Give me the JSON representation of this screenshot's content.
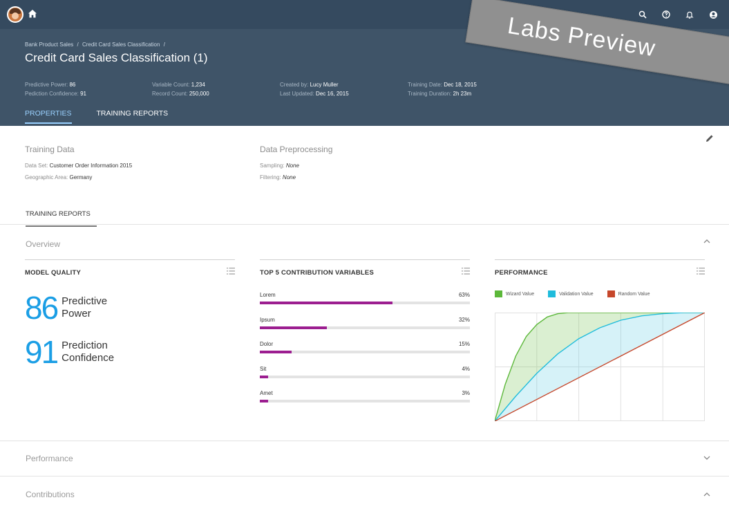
{
  "ribbon": {
    "text": "Labs Preview"
  },
  "breadcrumb": [
    "Bank Product Sales",
    "/",
    "Credit Card Sales Classification",
    "/"
  ],
  "title": "Credit Card Sales Classification (1)",
  "attributes": [
    [
      {
        "label": "Predictive Power:",
        "value": "86"
      },
      {
        "label": "Pediction Confidence:",
        "value": "91"
      }
    ],
    [
      {
        "label": "Variable Count:",
        "value": "1,234"
      },
      {
        "label": "Record Count:",
        "value": "250,000"
      }
    ],
    [
      {
        "label": "Created by:",
        "value": "Lucy Muller"
      },
      {
        "label": "Last Updated:",
        "value": "Dec 16, 2015"
      }
    ],
    [
      {
        "label": "Training Date:",
        "value": "Dec 18, 2015"
      },
      {
        "label": "Training Duration:",
        "value": "2h 23m"
      }
    ]
  ],
  "header_tabs": [
    {
      "label": "PROPERTIES",
      "active": true
    },
    {
      "label": "TRAINING REPORTS",
      "active": false
    }
  ],
  "training_data": {
    "title": "Training Data",
    "rows": [
      {
        "label": "Data Set:",
        "value": "Customer Order Information 2015"
      },
      {
        "label": "Geographic Area:",
        "value": "Germany"
      }
    ]
  },
  "data_preprocessing": {
    "title": "Data Preprocessing",
    "rows": [
      {
        "label": "Sampling:",
        "value": "None"
      },
      {
        "label": "Filtering:",
        "value": "None"
      }
    ]
  },
  "training_reports_tab": "TRAINING REPORTS",
  "panels": {
    "overview": "Overview",
    "performance": "Performance",
    "contributions": "Contributions"
  },
  "model_quality": {
    "title": "MODEL QUALITY",
    "kpis": [
      {
        "value": "86",
        "label": "Predictive Power"
      },
      {
        "value": "91",
        "label": "Prediction Confidence"
      }
    ]
  },
  "contribution": {
    "title": "TOP 5 CONTRIBUTION VARIABLES",
    "items": [
      {
        "name": "Lorem",
        "value": 63,
        "pct": "63%"
      },
      {
        "name": "Ipsum",
        "value": 32,
        "pct": "32%"
      },
      {
        "name": "Dolor",
        "value": 15,
        "pct": "15%"
      },
      {
        "name": "Sit",
        "value": 4,
        "pct": "4%"
      },
      {
        "name": "Amet",
        "value": 3,
        "pct": "3%"
      }
    ]
  },
  "performance": {
    "title": "PERFORMANCE"
  },
  "chart_data": {
    "type": "area",
    "title": "PERFORMANCE",
    "xlabel": "",
    "ylabel": "",
    "xlim": [
      0,
      1
    ],
    "ylim": [
      0,
      1
    ],
    "grid": true,
    "legend_position": "top-left",
    "series": [
      {
        "name": "Wizard Value",
        "color": "#5cb83a",
        "x": [
          0,
          0.05,
          0.1,
          0.15,
          0.2,
          0.25,
          0.3,
          0.35,
          0.4,
          0.45,
          0.5,
          1.0
        ],
        "y": [
          0,
          0.34,
          0.6,
          0.78,
          0.89,
          0.96,
          0.99,
          1.0,
          1.0,
          1.0,
          1.0,
          1.0
        ]
      },
      {
        "name": "Validation Value",
        "color": "#1fbcdc",
        "x": [
          0,
          0.1,
          0.2,
          0.3,
          0.4,
          0.5,
          0.6,
          0.7,
          0.8,
          0.9,
          1.0
        ],
        "y": [
          0,
          0.23,
          0.44,
          0.62,
          0.76,
          0.86,
          0.93,
          0.97,
          0.99,
          1.0,
          1.0
        ]
      },
      {
        "name": "Random Value",
        "color": "#c6472b",
        "x": [
          0,
          1
        ],
        "y": [
          0,
          1
        ]
      }
    ]
  }
}
